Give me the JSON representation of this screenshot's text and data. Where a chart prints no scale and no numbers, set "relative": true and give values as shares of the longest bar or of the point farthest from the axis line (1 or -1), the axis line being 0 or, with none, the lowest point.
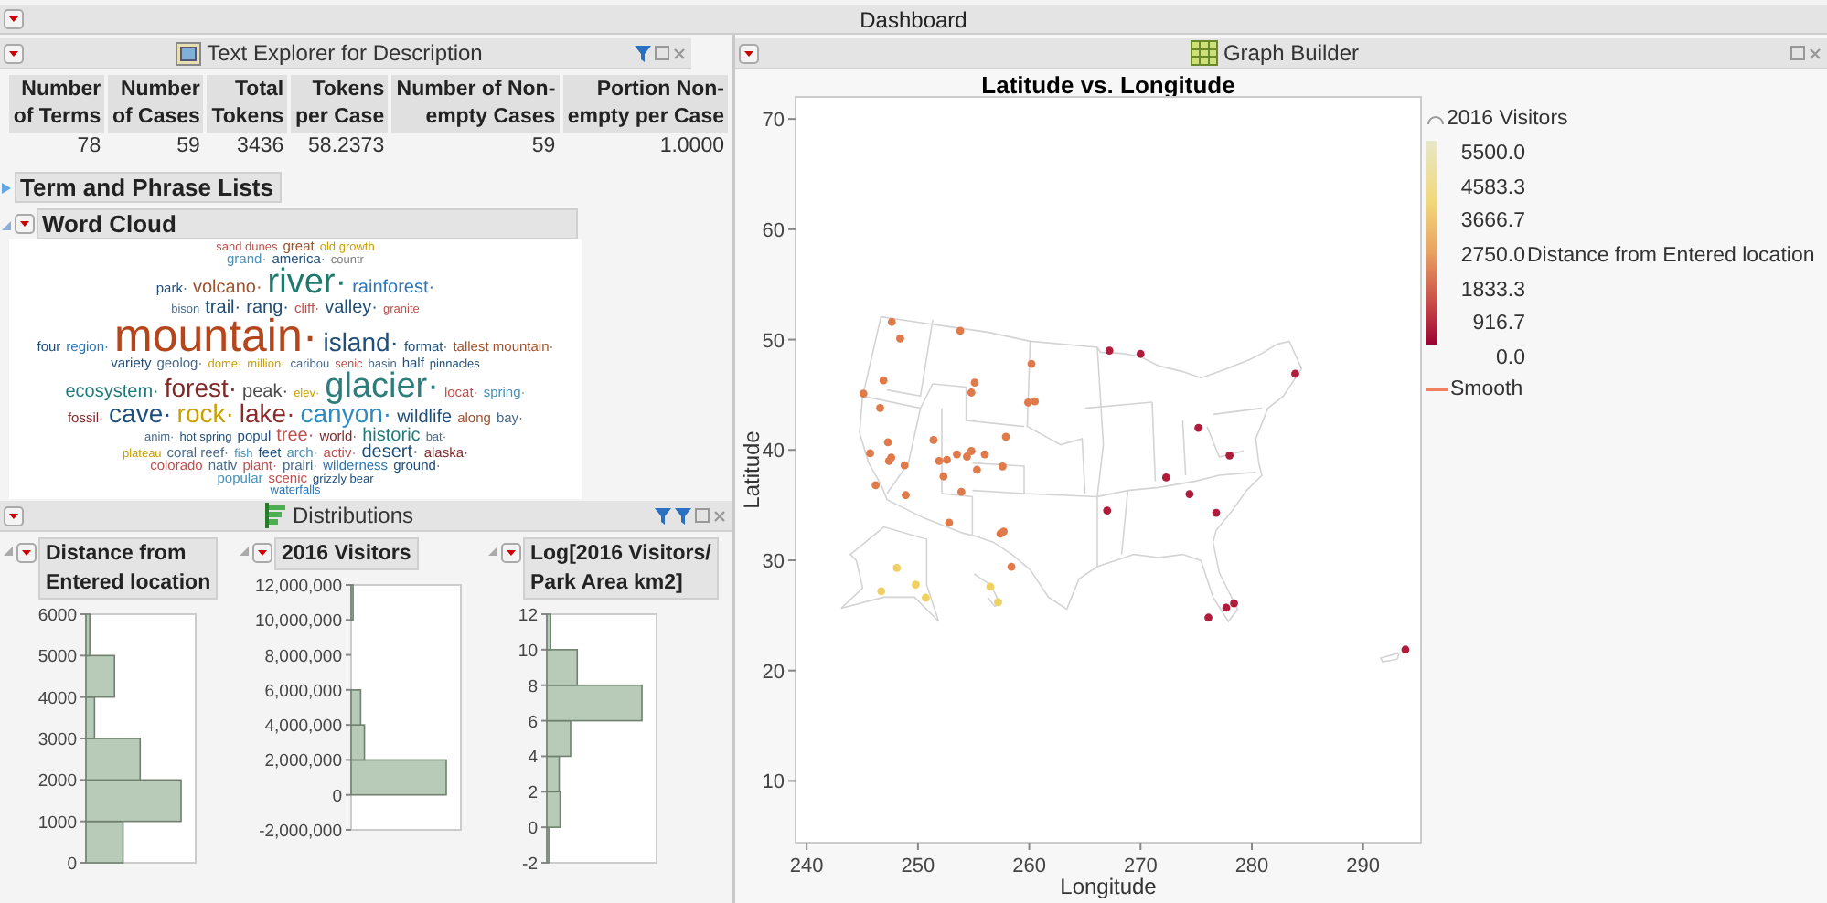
{
  "dashboard": {
    "title": "Dashboard"
  },
  "text_explorer": {
    "title": "Text Explorer for Description",
    "summary": {
      "columns": [
        "Number\nof Terms",
        "Number\nof Cases",
        "Total\nTokens",
        "Tokens\nper Case",
        "Number of Non-\nempty Cases",
        "Portion Non-\nempty per Case"
      ],
      "values": [
        "78",
        "59",
        "3436",
        "58.2373",
        "59",
        "1.0000"
      ]
    },
    "sections": [
      {
        "title": "Term and Phrase Lists",
        "expanded": false
      },
      {
        "title": "Word Cloud",
        "expanded": true
      }
    ],
    "word_cloud": [
      {
        "text": "sand dunes",
        "kind": "t",
        "color": "#c0504d"
      },
      {
        "text": "great",
        "kind": "s",
        "color": "#a0522d"
      },
      {
        "text": "old growth",
        "kind": "t",
        "color": "#c8a000"
      },
      {
        "text": "grand·",
        "kind": "s",
        "color": "#4a90b8"
      },
      {
        "text": "america·",
        "kind": "s",
        "color": "#1f4e79"
      },
      {
        "text": "countr",
        "kind": "t",
        "color": "#7f7f7f"
      },
      {
        "text": "park·",
        "kind": "s",
        "color": "#1f4e79"
      },
      {
        "text": "volcano·",
        "kind": "m",
        "color": "#a0522d"
      },
      {
        "text": "river·",
        "kind": "xl",
        "color": "#1f7a6e"
      },
      {
        "text": "rainforest·",
        "kind": "m",
        "color": "#2e75b6"
      },
      {
        "text": "bison",
        "kind": "t",
        "color": "#4a6a8a"
      },
      {
        "text": "trail·",
        "kind": "m",
        "color": "#1f4e79"
      },
      {
        "text": "rang·",
        "kind": "m",
        "color": "#1f4e79"
      },
      {
        "text": "cliff·",
        "kind": "s",
        "color": "#c0504d"
      },
      {
        "text": "valley·",
        "kind": "m",
        "color": "#1f4e79"
      },
      {
        "text": "granite",
        "kind": "t",
        "color": "#c0504d"
      },
      {
        "text": "four",
        "kind": "s",
        "color": "#1f4e79"
      },
      {
        "text": "region·",
        "kind": "s",
        "color": "#2e75b6"
      },
      {
        "text": "mountain·",
        "kind": "xxl",
        "color": "#b5451b"
      },
      {
        "text": "island·",
        "kind": "l",
        "color": "#1f4e79"
      },
      {
        "text": "format·",
        "kind": "s",
        "color": "#1f4e79"
      },
      {
        "text": "tallest mountain·",
        "kind": "s",
        "color": "#a0522d"
      },
      {
        "text": "variety",
        "kind": "s",
        "color": "#1f4e79"
      },
      {
        "text": "geolog·",
        "kind": "s",
        "color": "#4a6a8a"
      },
      {
        "text": "dome·",
        "kind": "t",
        "color": "#c8a000"
      },
      {
        "text": "million·",
        "kind": "t",
        "color": "#c8a000"
      },
      {
        "text": "caribou",
        "kind": "t",
        "color": "#4a6a8a"
      },
      {
        "text": "senic",
        "kind": "t",
        "color": "#c0504d"
      },
      {
        "text": "basin",
        "kind": "t",
        "color": "#4a6a8a"
      },
      {
        "text": "half",
        "kind": "s",
        "color": "#1f4e79"
      },
      {
        "text": "pinnacles",
        "kind": "t",
        "color": "#1f4e79"
      },
      {
        "text": "ecosystem·",
        "kind": "m",
        "color": "#1f7a7a"
      },
      {
        "text": "forest·",
        "kind": "l",
        "color": "#7f2a2a"
      },
      {
        "text": "peak·",
        "kind": "m",
        "color": "#4a4a4a"
      },
      {
        "text": "elev·",
        "kind": "t",
        "color": "#c8a000"
      },
      {
        "text": "glacier·",
        "kind": "xl",
        "color": "#2e7d7d"
      },
      {
        "text": "locat·",
        "kind": "s",
        "color": "#c0504d"
      },
      {
        "text": "spring·",
        "kind": "s",
        "color": "#4a90b8"
      },
      {
        "text": "fossil·",
        "kind": "s",
        "color": "#7f2a2a"
      },
      {
        "text": "cave·",
        "kind": "l",
        "color": "#1f4e79"
      },
      {
        "text": "rock·",
        "kind": "l",
        "color": "#c8a000"
      },
      {
        "text": "lake·",
        "kind": "l",
        "color": "#8b2a2a"
      },
      {
        "text": "canyon·",
        "kind": "l",
        "color": "#2e8bc0"
      },
      {
        "text": "wildlife",
        "kind": "m",
        "color": "#1f4e79"
      },
      {
        "text": "along",
        "kind": "s",
        "color": "#a0522d"
      },
      {
        "text": "bay·",
        "kind": "s",
        "color": "#4a6a8a"
      },
      {
        "text": "anim·",
        "kind": "t",
        "color": "#4a6a8a"
      },
      {
        "text": "hot spring",
        "kind": "t",
        "color": "#1f4e79"
      },
      {
        "text": "popul",
        "kind": "s",
        "color": "#1f4e79"
      },
      {
        "text": "tree·",
        "kind": "m",
        "color": "#c0504d"
      },
      {
        "text": "world·",
        "kind": "s",
        "color": "#7f2a2a"
      },
      {
        "text": "historic",
        "kind": "m",
        "color": "#1f7a7a"
      },
      {
        "text": "bat·",
        "kind": "t",
        "color": "#4a6a8a"
      },
      {
        "text": "plateau",
        "kind": "t",
        "color": "#c8a000"
      },
      {
        "text": "coral reef·",
        "kind": "s",
        "color": "#4a6a8a"
      },
      {
        "text": "fish",
        "kind": "t",
        "color": "#4a90b8"
      },
      {
        "text": "feet",
        "kind": "s",
        "color": "#1f4e79"
      },
      {
        "text": "arch·",
        "kind": "s",
        "color": "#4a90b8"
      },
      {
        "text": "activ·",
        "kind": "s",
        "color": "#c0504d"
      },
      {
        "text": "desert·",
        "kind": "m",
        "color": "#1f4e79"
      },
      {
        "text": "alaska·",
        "kind": "s",
        "color": "#7f2a2a"
      },
      {
        "text": "colorado",
        "kind": "s",
        "color": "#c0504d"
      },
      {
        "text": "nativ",
        "kind": "s",
        "color": "#4a6a8a"
      },
      {
        "text": "plant·",
        "kind": "s",
        "color": "#c0504d"
      },
      {
        "text": "prairi·",
        "kind": "s",
        "color": "#4a6a8a"
      },
      {
        "text": "wilderness",
        "kind": "s",
        "color": "#2e75b6"
      },
      {
        "text": "ground·",
        "kind": "s",
        "color": "#1f4e79"
      },
      {
        "text": "popular",
        "kind": "s",
        "color": "#4a90b8"
      },
      {
        "text": "scenic",
        "kind": "s",
        "color": "#c0504d"
      },
      {
        "text": "grizzly bear",
        "kind": "t",
        "color": "#1f4e79"
      },
      {
        "text": "waterfalls",
        "kind": "t",
        "color": "#2e75b6"
      }
    ]
  },
  "distributions": {
    "title": "Distributions",
    "charts": [
      {
        "title": "Distance from\nEntered location",
        "chart_data": {
          "type": "bar",
          "orientation": "horizontal",
          "relative": true,
          "x": [
            500,
            1500,
            2500,
            3500,
            4500,
            5500
          ],
          "ylim": [
            0,
            6000
          ],
          "yticks": [
            0,
            1000,
            2000,
            3000,
            4000,
            5000,
            6000
          ],
          "series": [
            {
              "color": "#b8cbb8",
              "values": [
                0.39,
                1,
                0.57,
                0.09,
                0.3,
                0.04
              ]
            }
          ]
        }
      },
      {
        "title": "2016 Visitors",
        "chart_data": {
          "type": "bar",
          "orientation": "horizontal",
          "relative": true,
          "x": [
            1000000,
            3000000,
            5000000,
            7000000,
            9000000,
            11000000
          ],
          "ylim": [
            -2000000,
            12000000
          ],
          "yticks": [
            {
              "value": -2000000,
              "label": "-2,000,000"
            },
            {
              "value": 0,
              "label": "0"
            },
            {
              "value": 2000000,
              "label": "2,000,000"
            },
            {
              "value": 4000000,
              "label": "4,000,000"
            },
            {
              "value": 6000000,
              "label": "6,000,000"
            },
            {
              "value": 8000000,
              "label": "8,000,000"
            },
            {
              "value": 10000000,
              "label": "10,000,000"
            },
            {
              "value": 12000000,
              "label": "12,000,000"
            }
          ],
          "series": [
            {
              "color": "#b8cbb8",
              "values": [
                1,
                0.14,
                0.1,
                0,
                0,
                0.02
              ]
            }
          ]
        }
      },
      {
        "title": "Log[2016 Visitors/\nPark Area km2]",
        "chart_data": {
          "type": "bar",
          "orientation": "horizontal",
          "relative": true,
          "x": [
            -1,
            1,
            3,
            5,
            7,
            9,
            11
          ],
          "ylim": [
            -2,
            12
          ],
          "yticks": [
            -2,
            0,
            2,
            4,
            6,
            8,
            10,
            12
          ],
          "series": [
            {
              "color": "#b8cbb8",
              "values": [
                0.02,
                0.14,
                0.13,
                0.25,
                1,
                0.32,
                0.04
              ]
            }
          ]
        }
      }
    ]
  },
  "graph_builder": {
    "title": "Graph Builder",
    "chart_data": {
      "type": "scatter",
      "title": "Latitude vs. Longitude",
      "xlabel": "Longitude",
      "ylabel": "Latitude",
      "xlim": [
        239,
        295.2
      ],
      "ylim": [
        4.4,
        72
      ],
      "xticks": [
        240,
        250,
        260,
        270,
        280,
        290
      ],
      "yticks": [
        10,
        20,
        30,
        40,
        50,
        60,
        70
      ],
      "x": [
        247.65,
        248.4,
        253.8,
        255.1,
        254.8,
        246.9,
        245.1,
        246.6,
        247.3,
        247.6,
        247.4,
        245.7,
        248.8,
        248.9,
        246.2,
        251.4,
        251.9,
        252.6,
        252.3,
        253.5,
        254.4,
        254.8,
        256.0,
        255.3,
        253.9,
        252.8,
        257.9,
        257.6,
        257.4,
        257.7,
        258.4,
        260.2,
        259.9,
        260.5,
        267.2,
        270.0,
        267.0,
        272.3,
        274.4,
        275.2,
        278.0,
        276.8,
        283.9,
        277.7,
        278.4,
        276.1,
        293.8,
        248.1,
        246.7,
        250.7,
        256.5,
        257.2,
        249.8
      ],
      "series": [
        {
          "color": "#e07a4a",
          "values": [
            51.6,
            50.1,
            50.8,
            46.1,
            45.2,
            46.3,
            45.1,
            43.8,
            40.7,
            39.3,
            39.0,
            39.7,
            38.6,
            35.9,
            36.8,
            40.9,
            39.0,
            39.1,
            37.6,
            39.6,
            39.4,
            39.9,
            39.6,
            38.2,
            36.2,
            33.4,
            41.2,
            38.5,
            32.4,
            32.6,
            29.4,
            47.8,
            44.3,
            44.4,
            null,
            null,
            null,
            null,
            null,
            null,
            null,
            null,
            null,
            null,
            null,
            null,
            null,
            null,
            null,
            null,
            null,
            null,
            null
          ]
        },
        {
          "color": "#b01c3c",
          "values": [
            null,
            null,
            null,
            null,
            null,
            null,
            null,
            null,
            null,
            null,
            null,
            null,
            null,
            null,
            null,
            null,
            null,
            null,
            null,
            null,
            null,
            null,
            null,
            null,
            null,
            null,
            null,
            null,
            null,
            null,
            null,
            null,
            null,
            null,
            49.0,
            48.7,
            34.5,
            37.5,
            36.0,
            42.0,
            39.5,
            34.3,
            46.9,
            25.7,
            26.1,
            24.8,
            21.9,
            null,
            null,
            null,
            null,
            null,
            null
          ]
        },
        {
          "color": "#f0d060",
          "values": [
            null,
            null,
            null,
            null,
            null,
            null,
            null,
            null,
            null,
            null,
            null,
            null,
            null,
            null,
            null,
            null,
            null,
            null,
            null,
            null,
            null,
            null,
            null,
            null,
            null,
            null,
            null,
            null,
            null,
            null,
            null,
            null,
            null,
            null,
            null,
            null,
            null,
            null,
            null,
            null,
            null,
            null,
            null,
            null,
            null,
            null,
            null,
            29.3,
            27.2,
            26.6,
            27.6,
            26.2,
            27.8
          ]
        }
      ]
    },
    "legend": {
      "size_title": "2016 Visitors",
      "color_title": "Distance from Entered location",
      "color_labels": [
        "5500.0",
        "4583.3",
        "3666.7",
        "2750.0",
        "1833.3",
        "916.7",
        "0.0"
      ],
      "line_label": "Smooth"
    }
  }
}
